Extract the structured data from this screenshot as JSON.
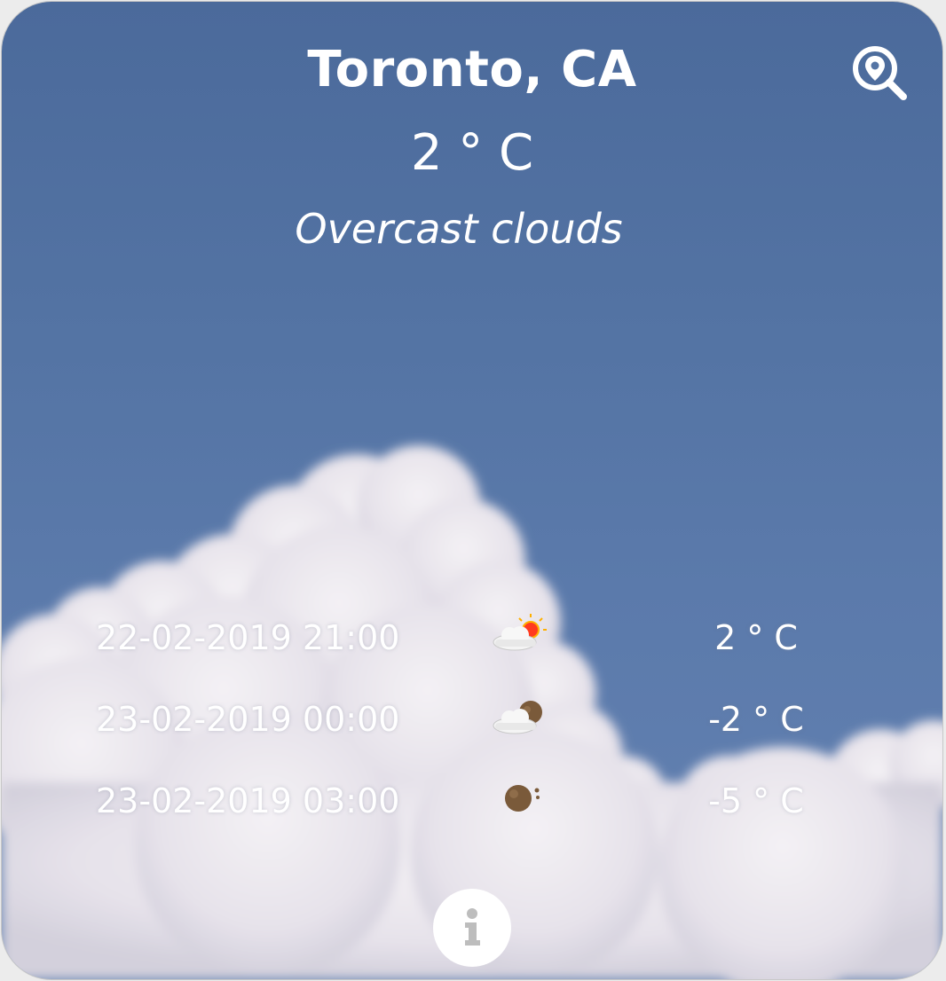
{
  "header": {
    "city": "Toronto, CA",
    "current_temp": "2 ° C",
    "description": "Overcast clouds"
  },
  "forecast": [
    {
      "datetime": "22-02-2019 21:00",
      "icon": "cloud-sun-icon",
      "temp": "2 ° C"
    },
    {
      "datetime": "23-02-2019 00:00",
      "icon": "cloud-moon-icon",
      "temp": "-2 ° C"
    },
    {
      "datetime": "23-02-2019 03:00",
      "icon": "moon-icon",
      "temp": "-5 ° C"
    }
  ],
  "colors": {
    "sky": "#5474a4",
    "text": "#ffffff",
    "sun": "#ff3b1f",
    "moon": "#7a5a3a"
  }
}
